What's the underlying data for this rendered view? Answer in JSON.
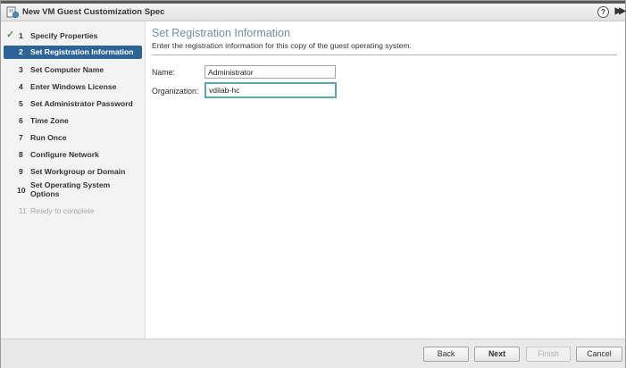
{
  "window": {
    "title": "New VM Guest Customization Spec"
  },
  "steps": [
    {
      "num": "1",
      "label": "Specify Properties",
      "state": "complete"
    },
    {
      "num": "2",
      "label": "Set Registration Information",
      "state": "active"
    },
    {
      "num": "3",
      "label": "Set Computer Name",
      "state": "pending"
    },
    {
      "num": "4",
      "label": "Enter Windows License",
      "state": "pending"
    },
    {
      "num": "5",
      "label": "Set Administrator Password",
      "state": "pending"
    },
    {
      "num": "6",
      "label": "Time Zone",
      "state": "pending"
    },
    {
      "num": "7",
      "label": "Run Once",
      "state": "pending"
    },
    {
      "num": "8",
      "label": "Configure Network",
      "state": "pending"
    },
    {
      "num": "9",
      "label": "Set Workgroup or Domain",
      "state": "pending"
    },
    {
      "num": "10",
      "label": "Set Operating System Options",
      "state": "pending"
    },
    {
      "num": "11",
      "label": "Ready to complete",
      "state": "disabled"
    }
  ],
  "main": {
    "heading": "Set Registration Information",
    "subtitle": "Enter the registration information for this copy of the guest operating system.",
    "form": {
      "name_label": "Name:",
      "name_value": "Administrator",
      "org_label": "Organization:",
      "org_value": "vdilab-hc"
    }
  },
  "footer": {
    "back": "Back",
    "next": "Next",
    "finish": "Finish",
    "cancel": "Cancel"
  },
  "colors": {
    "active_step": "#2c6497",
    "heading": "#6f8ea8",
    "focus_border": "#5aa6b3",
    "check": "#4a9b3b"
  }
}
